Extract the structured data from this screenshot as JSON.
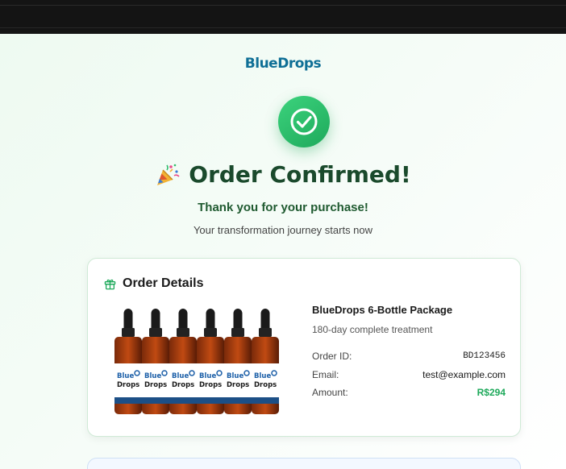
{
  "brand": {
    "name": "BlueDrops"
  },
  "header": {
    "title": "Order Confirmed!",
    "subtitle": "Thank you for your purchase!",
    "tagline": "Your transformation journey starts now"
  },
  "order_details": {
    "heading": "Order Details",
    "product_name": "BlueDrops 6-Bottle Package",
    "product_description": "180-day complete treatment",
    "fields": [
      {
        "label": "Order ID:",
        "value": "BD123456"
      },
      {
        "label": "Email:",
        "value": "test@example.com"
      },
      {
        "label": "Amount:",
        "value": "R$294"
      }
    ]
  },
  "colors": {
    "accent_green": "#1ea95b",
    "title_green": "#1a4a2c",
    "brand_blue": "#0f6f96"
  },
  "icons": [
    "check-circle-icon",
    "party-popper-icon",
    "gift-icon"
  ]
}
